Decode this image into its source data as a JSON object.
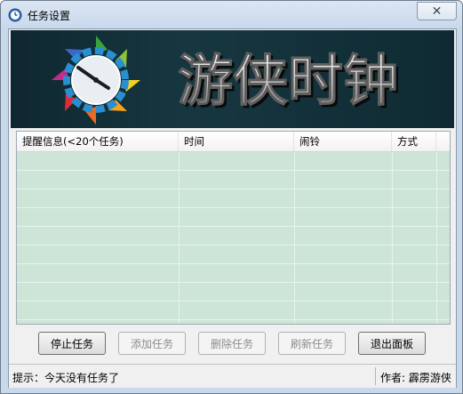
{
  "window": {
    "title": "任务设置",
    "close_glyph": "✕"
  },
  "banner": {
    "title": "游侠时钟",
    "logo_icon": "colorful-clock-icon"
  },
  "table": {
    "columns": [
      "提醒信息(<20个任务)",
      "时间",
      "闹铃",
      "方式"
    ],
    "rows": [],
    "row_color": "#cce5d6"
  },
  "buttons": {
    "stop": "停止任务",
    "add": "添加任务",
    "delete": "删除任务",
    "refresh": "刷新任务",
    "exit": "退出面板"
  },
  "status": {
    "hint": "提示：今天没有任务了",
    "author": "作者: 霹雳游侠"
  }
}
